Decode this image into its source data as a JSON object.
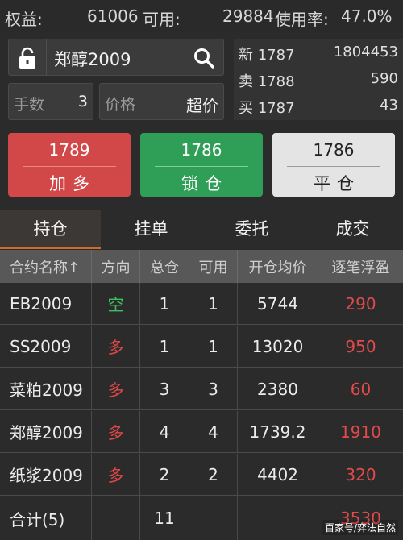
{
  "account": {
    "equity_label": "权益:",
    "equity_value": "61006",
    "available_label": "可用:",
    "available_value": "29884",
    "usage_label": "使用率:",
    "usage_value": "47.0%"
  },
  "order": {
    "symbol": "郑醇2009",
    "qty_label": "手数",
    "qty_value": "3",
    "price_label": "价格",
    "price_value": "超价"
  },
  "quote": [
    {
      "label": "新",
      "price": "1787",
      "value": "1804453"
    },
    {
      "label": "卖",
      "price": "1788",
      "value": "590"
    },
    {
      "label": "买",
      "price": "1787",
      "value": "43"
    }
  ],
  "actions": {
    "buy": {
      "price": "1789",
      "label": "加多"
    },
    "lock": {
      "price": "1786",
      "label": "锁仓"
    },
    "flat": {
      "price": "1786",
      "label": "平仓"
    }
  },
  "tabs": [
    "持仓",
    "挂单",
    "委托",
    "成交"
  ],
  "active_tab": "持仓",
  "table": {
    "headers": [
      "合约名称↑",
      "方向",
      "总仓",
      "可用",
      "开仓均价",
      "逐笔浮盈"
    ],
    "rows": [
      {
        "name": "EB2009",
        "dir": "空",
        "total": "1",
        "avail": "1",
        "avg": "5744",
        "pnl": "290"
      },
      {
        "name": "SS2009",
        "dir": "多",
        "total": "1",
        "avail": "1",
        "avg": "13020",
        "pnl": "950"
      },
      {
        "name": "菜粕2009",
        "dir": "多",
        "total": "3",
        "avail": "3",
        "avg": "2380",
        "pnl": "60"
      },
      {
        "name": "郑醇2009",
        "dir": "多",
        "total": "4",
        "avail": "4",
        "avg": "1739.2",
        "pnl": "1910"
      },
      {
        "name": "纸浆2009",
        "dir": "多",
        "total": "2",
        "avail": "2",
        "avg": "4402",
        "pnl": "320"
      }
    ],
    "summary": {
      "name": "合计(5)",
      "total": "11",
      "pnl": "3530"
    }
  },
  "watermark": "百家号/弈法自然",
  "colors": {
    "buy": "#d24848",
    "lock": "#2f9e57",
    "flat": "#e4e4e4",
    "short": "#3fbf5f",
    "long": "#e04848",
    "tab_accent": "#d46a2a"
  }
}
